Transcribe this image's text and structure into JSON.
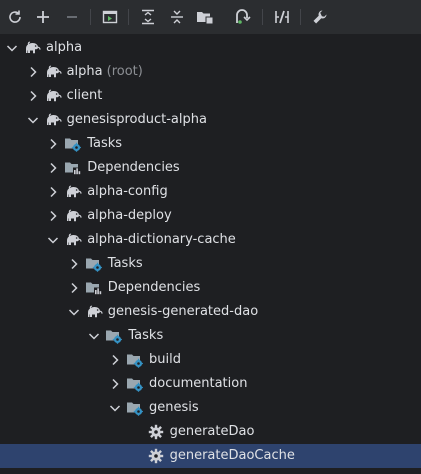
{
  "toolbar": {
    "buttons": [
      {
        "icon": "refresh-icon"
      },
      {
        "icon": "add-icon"
      },
      {
        "icon": "remove-icon"
      },
      {
        "icon": "run-task-icon"
      },
      {
        "icon": "expand-all-icon"
      },
      {
        "icon": "collapse-all-icon"
      },
      {
        "icon": "group-modules-icon"
      },
      {
        "icon": "analyze-dependencies-icon"
      },
      {
        "icon": "toggle-offline-icon"
      },
      {
        "icon": "settings-wrench-icon"
      }
    ]
  },
  "tree": {
    "selected_index": 17,
    "nodes": [
      {
        "label": "alpha",
        "suffix": "",
        "icon": "elephant-icon",
        "depth": 0,
        "expanded": true
      },
      {
        "label": "alpha",
        "suffix": "(root)",
        "icon": "elephant-icon",
        "depth": 1,
        "expanded": false
      },
      {
        "label": "client",
        "suffix": "",
        "icon": "elephant-icon",
        "depth": 1,
        "expanded": false
      },
      {
        "label": "genesisproduct-alpha",
        "suffix": "",
        "icon": "elephant-icon",
        "depth": 1,
        "expanded": true
      },
      {
        "label": "Tasks",
        "suffix": "",
        "icon": "task-folder-icon",
        "depth": 2,
        "expanded": false
      },
      {
        "label": "Dependencies",
        "suffix": "",
        "icon": "dependencies-icon",
        "depth": 2,
        "expanded": false
      },
      {
        "label": "alpha-config",
        "suffix": "",
        "icon": "elephant-icon",
        "depth": 2,
        "expanded": false
      },
      {
        "label": "alpha-deploy",
        "suffix": "",
        "icon": "elephant-icon",
        "depth": 2,
        "expanded": false
      },
      {
        "label": "alpha-dictionary-cache",
        "suffix": "",
        "icon": "elephant-icon",
        "depth": 2,
        "expanded": true
      },
      {
        "label": "Tasks",
        "suffix": "",
        "icon": "task-folder-icon",
        "depth": 3,
        "expanded": false
      },
      {
        "label": "Dependencies",
        "suffix": "",
        "icon": "dependencies-icon",
        "depth": 3,
        "expanded": false
      },
      {
        "label": "genesis-generated-dao",
        "suffix": "",
        "icon": "elephant-icon",
        "depth": 3,
        "expanded": true
      },
      {
        "label": "Tasks",
        "suffix": "",
        "icon": "task-folder-icon",
        "depth": 4,
        "expanded": true
      },
      {
        "label": "build",
        "suffix": "",
        "icon": "task-folder-icon",
        "depth": 5,
        "expanded": false
      },
      {
        "label": "documentation",
        "suffix": "",
        "icon": "task-folder-icon",
        "depth": 5,
        "expanded": false
      },
      {
        "label": "genesis",
        "suffix": "",
        "icon": "task-folder-icon",
        "depth": 5,
        "expanded": true
      },
      {
        "label": "generateDao",
        "suffix": "",
        "icon": "gear-icon",
        "depth": 6,
        "expanded": null
      },
      {
        "label": "generateDaoCache",
        "suffix": "",
        "icon": "gear-icon",
        "depth": 6,
        "expanded": null
      }
    ]
  },
  "colors": {
    "background": "#1e1f22",
    "toolbar": "#2b2d30",
    "selection": "#2e436e",
    "text": "#dfe1e5",
    "muted": "#8c8f94",
    "folder": "#9aa7b0",
    "gear": "#3592c4",
    "icon": "#ced0d6"
  }
}
